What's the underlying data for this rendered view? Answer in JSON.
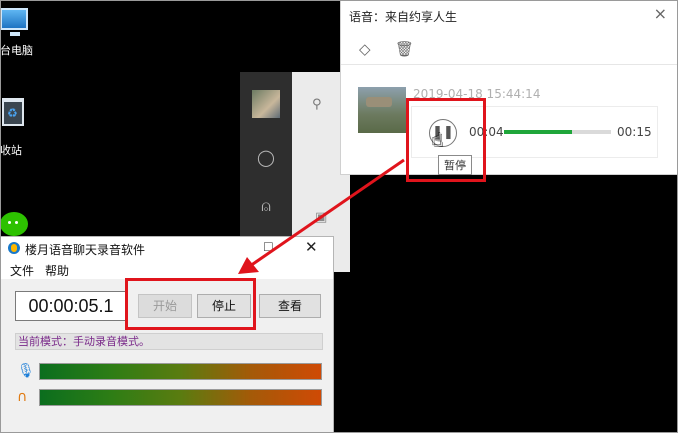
{
  "desktop": {
    "icons": [
      {
        "label": "台电脑",
        "icon": "computer-icon"
      },
      {
        "label": "收站",
        "icon": "recycle-bin-icon"
      },
      {
        "label": "",
        "icon": "wechat-icon"
      }
    ]
  },
  "voice_popup": {
    "title": "语音：来自约享人生",
    "close": "×",
    "toolbar": {
      "tag_icon": "tag-icon",
      "delete_icon": "trash-icon"
    },
    "timestamp": "2019-04-18 15:44:14",
    "player": {
      "state_icon": "pause-icon",
      "current_time": "00:04",
      "total_time": "00:15",
      "progress": 0.64,
      "progress_color": "#1fa63a"
    },
    "tooltip": "暂停"
  },
  "recorder": {
    "title": "楼月语音聊天录音软件",
    "menu": [
      "文件",
      "帮助"
    ],
    "clock": "00:00:05.1",
    "buttons": {
      "start": "开始",
      "stop": "停止",
      "view": "查看"
    },
    "status": "当前模式：手动录音模式。",
    "meters": [
      {
        "icon": "microphone-icon"
      },
      {
        "icon": "headphones-icon"
      }
    ]
  },
  "annotations": {
    "highlight_color": "#e0141c"
  }
}
